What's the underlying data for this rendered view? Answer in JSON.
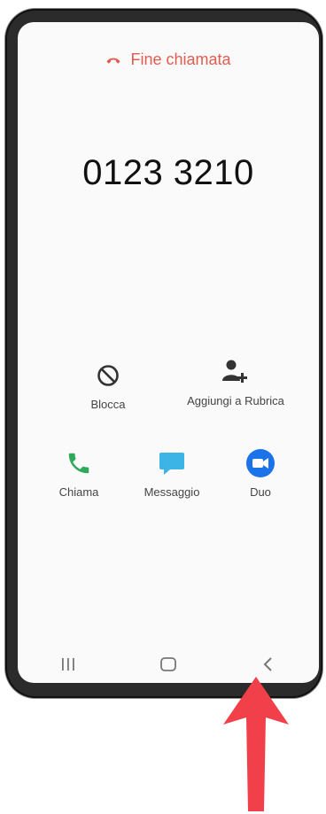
{
  "status": {
    "label": "Fine chiamata"
  },
  "call": {
    "number": "0123 3210"
  },
  "actions": {
    "block": {
      "label": "Blocca",
      "icon": "block-icon"
    },
    "add_contact": {
      "label": "Aggiungi a Rubrica",
      "icon": "add-contact-icon"
    },
    "call": {
      "label": "Chiama",
      "icon": "phone-icon",
      "color": "#2eaa5a"
    },
    "message": {
      "label": "Messaggio",
      "icon": "message-icon",
      "color": "#3cb4e6"
    },
    "duo": {
      "label": "Duo",
      "icon": "duo-video-icon",
      "color": "#1a73e8"
    }
  },
  "navbar": {
    "items": [
      "recent-apps-icon",
      "home-icon",
      "back-icon"
    ]
  },
  "annotation": {
    "color": "#f2404a",
    "icon": "arrow-up-icon"
  }
}
